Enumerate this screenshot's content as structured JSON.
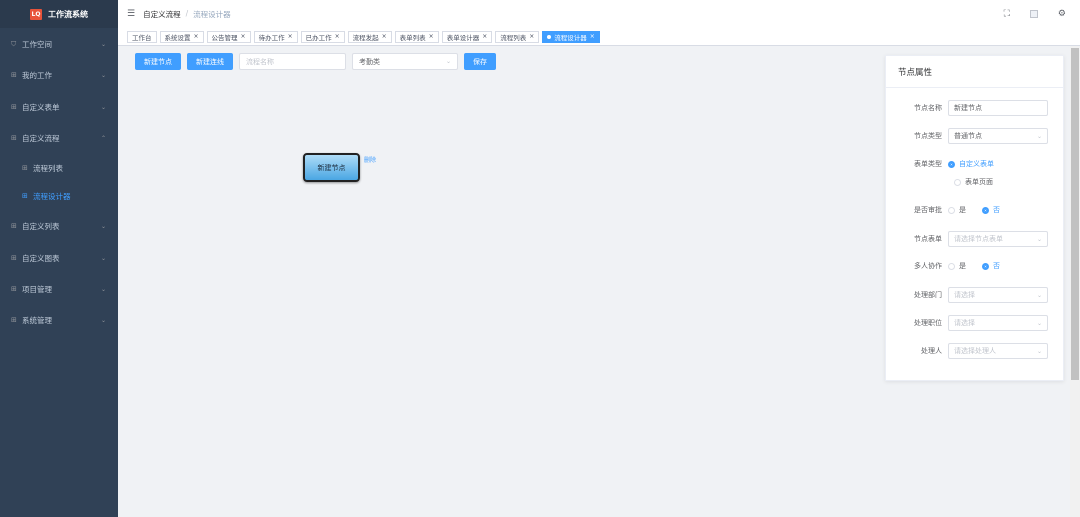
{
  "app": {
    "logo_mark": "LQ",
    "title": "工作流系统"
  },
  "sidebar": {
    "items": [
      {
        "label": "工作空间",
        "icon": "shield-icon"
      },
      {
        "label": "我的工作",
        "icon": "grid-icon"
      },
      {
        "label": "自定义表单",
        "icon": "grid-icon"
      },
      {
        "label": "自定义流程",
        "icon": "grid-icon"
      },
      {
        "label": "流程列表",
        "icon": "grid-icon"
      },
      {
        "label": "流程设计器",
        "icon": "grid-icon"
      },
      {
        "label": "自定义列表",
        "icon": "grid-icon"
      },
      {
        "label": "自定义图表",
        "icon": "grid-icon"
      },
      {
        "label": "项目管理",
        "icon": "grid-icon"
      },
      {
        "label": "系统管理",
        "icon": "grid-icon"
      }
    ]
  },
  "header": {
    "breadcrumb": [
      "自定义流程",
      "流程设计器"
    ],
    "separator": "/"
  },
  "tags": [
    {
      "label": "工作台"
    },
    {
      "label": "系统设置"
    },
    {
      "label": "公告管理"
    },
    {
      "label": "待办工作"
    },
    {
      "label": "已办工作"
    },
    {
      "label": "流程发起"
    },
    {
      "label": "表单列表"
    },
    {
      "label": "表单设计器"
    },
    {
      "label": "流程列表"
    },
    {
      "label": "流程设计器"
    }
  ],
  "toolbar": {
    "new_node": "新建节点",
    "new_line": "新建连线",
    "name_placeholder": "流程名称",
    "category_value": "考勤类",
    "save": "保存"
  },
  "canvas": {
    "node_label": "新建节点",
    "node_delete": "删除"
  },
  "panel": {
    "title": "节点属性",
    "node_name_label": "节点名称",
    "node_name_value": "新建节点",
    "node_type_label": "节点类型",
    "node_type_value": "普通节点",
    "form_type_label": "表单类型",
    "form_type_opt1": "自定义表单",
    "form_type_opt2": "表单页面",
    "approve_label": "是否审批",
    "yes": "是",
    "no": "否",
    "node_form_label": "节点表单",
    "node_form_placeholder": "请选择节点表单",
    "multi_label": "多人协作",
    "dept_label": "处理部门",
    "dept_placeholder": "请选择",
    "position_label": "处理职位",
    "position_placeholder": "请选择",
    "handler_label": "处理人",
    "handler_placeholder": "请选择处理人"
  }
}
